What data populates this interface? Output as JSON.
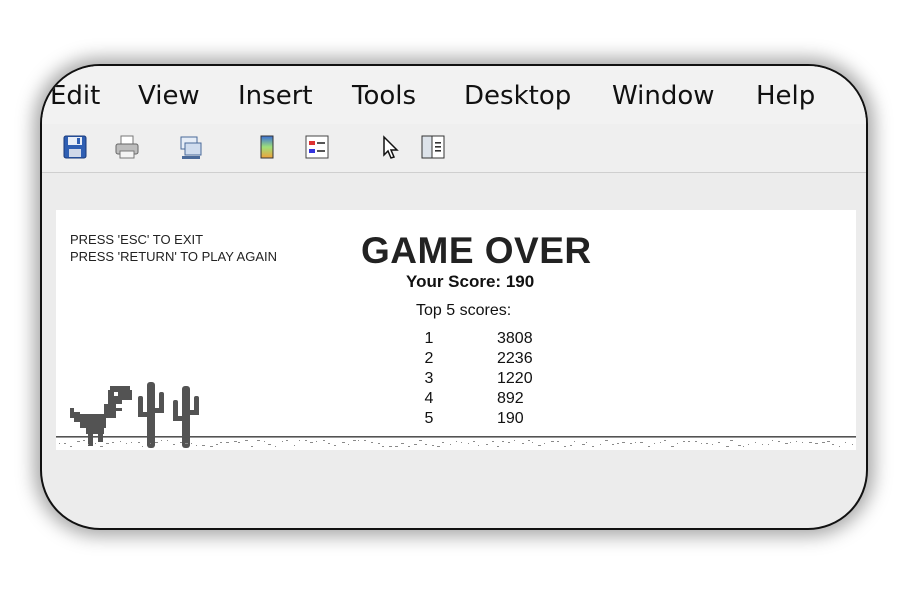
{
  "menubar": {
    "items": [
      "Edit",
      "View",
      "Insert",
      "Tools",
      "Desktop",
      "Window",
      "Help"
    ]
  },
  "toolbar": {
    "icons": [
      "save-icon",
      "print-icon",
      "link-icon",
      "colorbar-icon",
      "legend-icon",
      "pointer-icon",
      "property-editor-icon"
    ]
  },
  "game": {
    "instruction_exit": "PRESS 'ESC' TO EXIT",
    "instruction_replay": "PRESS 'RETURN' TO PLAY AGAIN",
    "title": "GAME OVER",
    "your_score": "Your Score: 190",
    "top_scores_label": "Top 5 scores:",
    "top_scores": [
      {
        "rank": "1",
        "score": "3808"
      },
      {
        "rank": "2",
        "score": "2236"
      },
      {
        "rank": "3",
        "score": "1220"
      },
      {
        "rank": "4",
        "score": "892"
      },
      {
        "rank": "5",
        "score": "190"
      }
    ]
  },
  "colors": {
    "dino": "#535353",
    "ground": "#535353",
    "background": "#ffffff"
  }
}
